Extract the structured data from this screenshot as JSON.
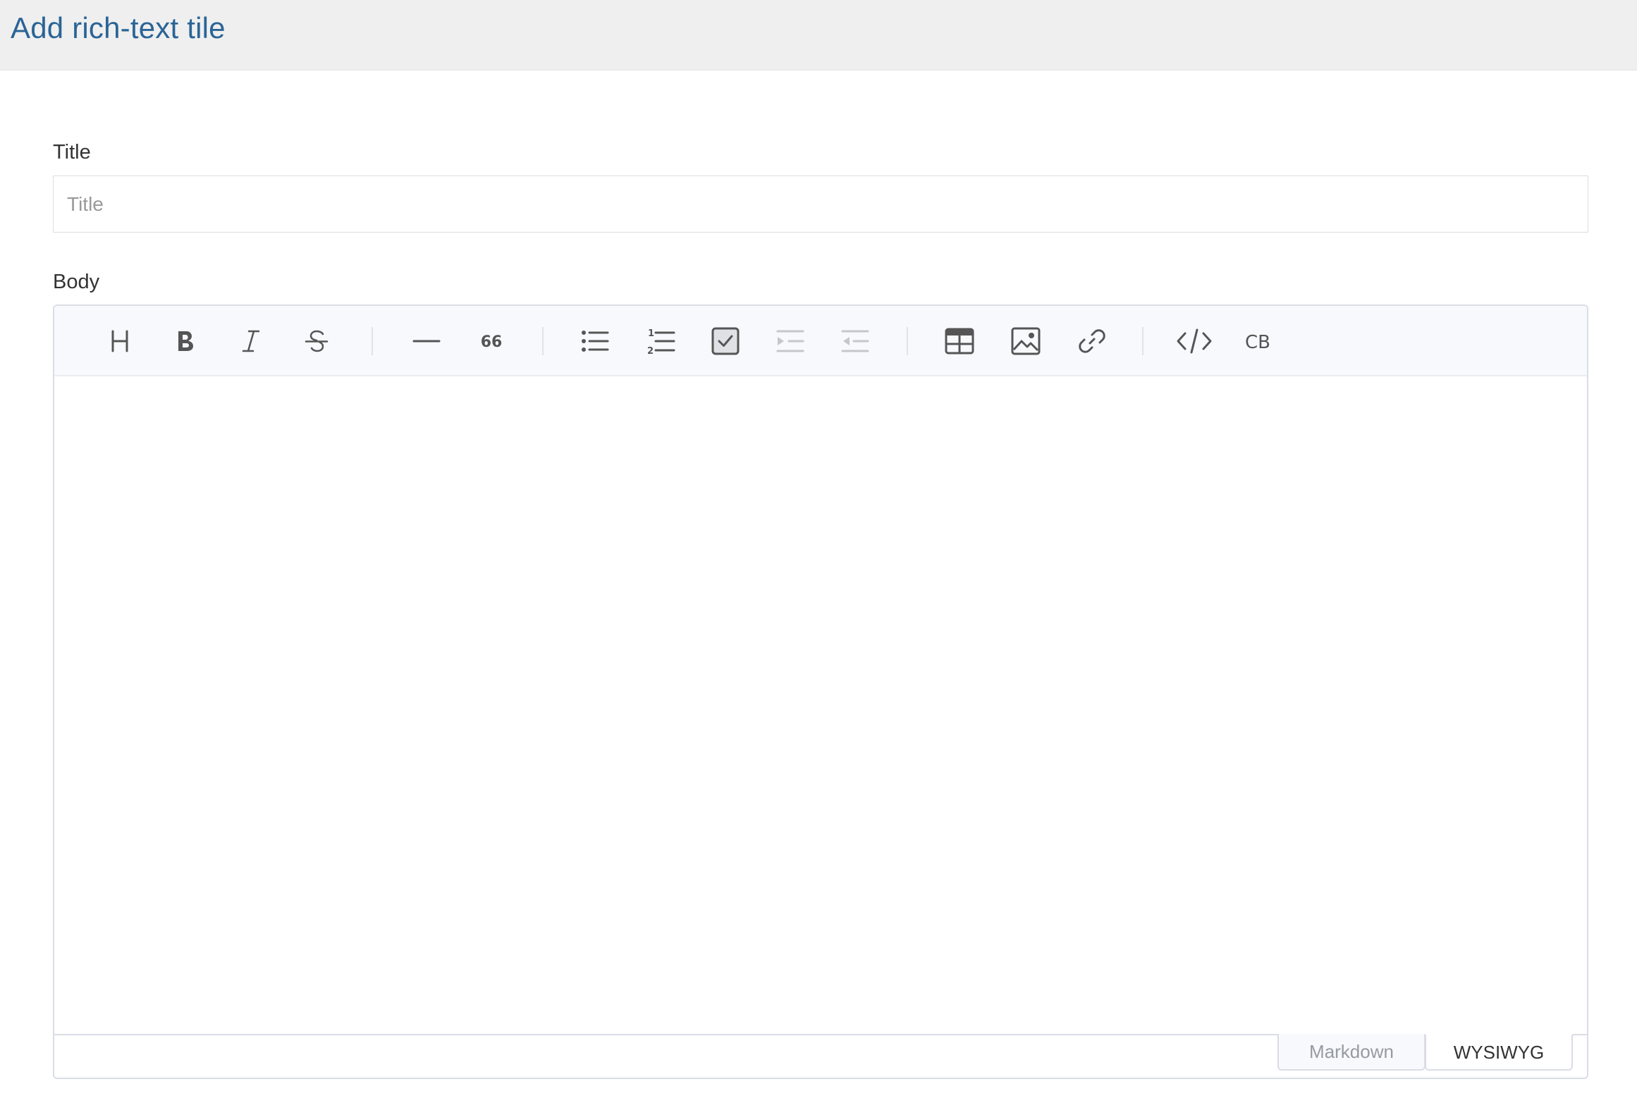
{
  "header": {
    "title": "Add rich-text tile"
  },
  "form": {
    "title_label": "Title",
    "title_placeholder": "Title",
    "title_value": "",
    "body_label": "Body"
  },
  "toolbar": {
    "groups": [
      [
        {
          "name": "heading",
          "icon": "heading-icon",
          "label": "H"
        },
        {
          "name": "bold",
          "icon": "bold-icon",
          "label": "B"
        },
        {
          "name": "italic",
          "icon": "italic-icon",
          "label": "I"
        },
        {
          "name": "strike",
          "icon": "strikethrough-icon",
          "label": "S"
        }
      ],
      [
        {
          "name": "hr",
          "icon": "horizontal-rule-icon"
        },
        {
          "name": "quote",
          "icon": "blockquote-icon",
          "label": "66"
        }
      ],
      [
        {
          "name": "ul",
          "icon": "bullet-list-icon"
        },
        {
          "name": "ol",
          "icon": "numbered-list-icon"
        },
        {
          "name": "task",
          "icon": "task-list-icon"
        },
        {
          "name": "indent",
          "icon": "indent-icon",
          "disabled": true
        },
        {
          "name": "outdent",
          "icon": "outdent-icon",
          "disabled": true
        }
      ],
      [
        {
          "name": "table",
          "icon": "table-icon"
        },
        {
          "name": "image",
          "icon": "image-icon"
        },
        {
          "name": "link",
          "icon": "link-icon"
        }
      ],
      [
        {
          "name": "code",
          "icon": "code-icon"
        },
        {
          "name": "codeblock",
          "icon": "codeblock-icon",
          "label": "CB"
        }
      ]
    ]
  },
  "editor": {
    "content": "",
    "modes": [
      "Markdown",
      "WYSIWYG"
    ],
    "active_mode": "WYSIWYG"
  },
  "colors": {
    "accent": "#2a6496",
    "icon": "#555555",
    "icon_disabled": "#c4c7cc"
  }
}
